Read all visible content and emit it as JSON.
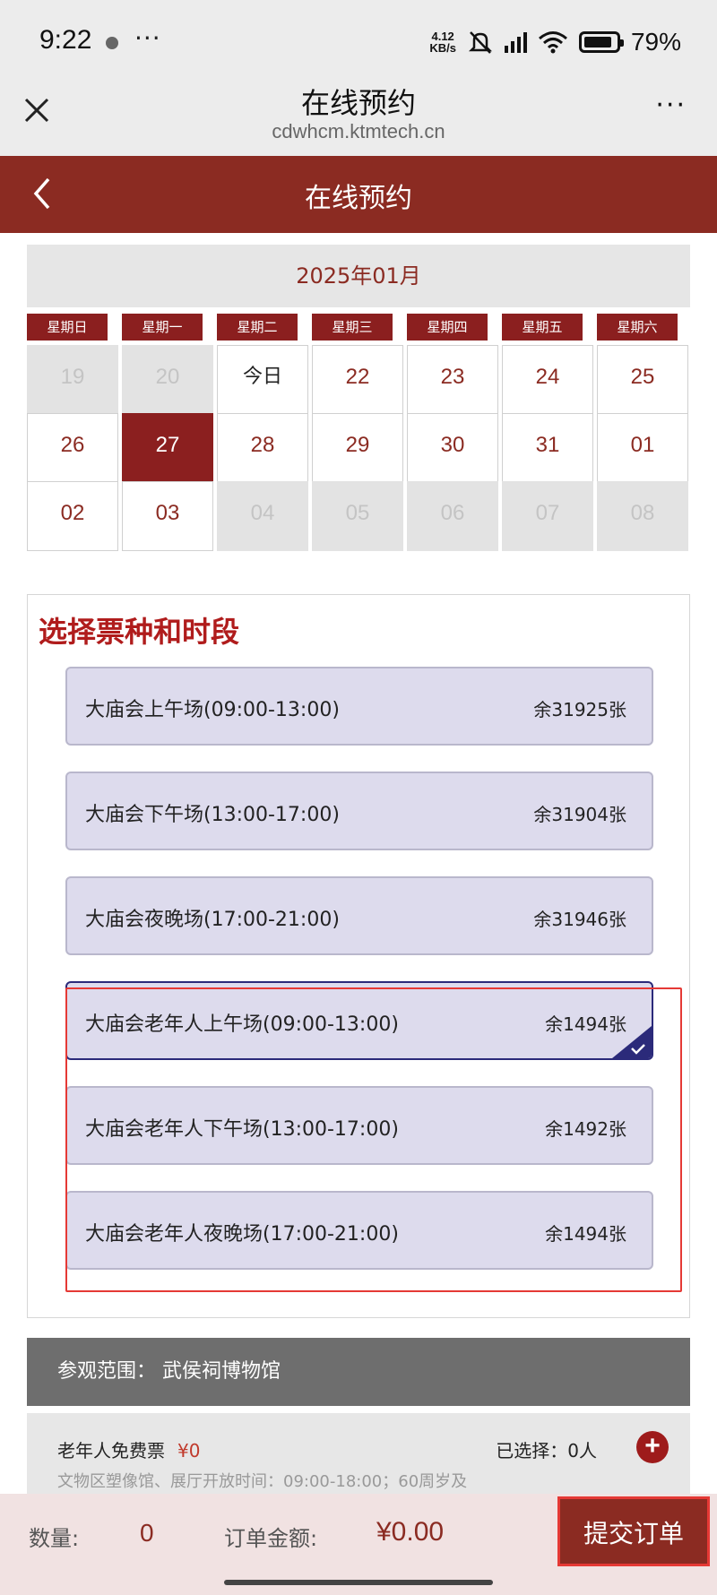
{
  "status": {
    "time": "9:22",
    "more": "···",
    "net_speed_top": "4.12",
    "net_speed_bottom": "KB/s",
    "battery": "79%"
  },
  "browser": {
    "title": "在线预约",
    "url": "cdwhcm.ktmtech.cn",
    "more": "···"
  },
  "header": {
    "title": "在线预约"
  },
  "calendar": {
    "month": "2025年01月",
    "weekdays": [
      "星期日",
      "星期一",
      "星期二",
      "星期三",
      "星期四",
      "星期五",
      "星期六"
    ],
    "days": [
      {
        "label": "19",
        "state": "disabled"
      },
      {
        "label": "20",
        "state": "disabled"
      },
      {
        "label": "今日",
        "state": "today"
      },
      {
        "label": "22",
        "state": "available"
      },
      {
        "label": "23",
        "state": "available"
      },
      {
        "label": "24",
        "state": "available"
      },
      {
        "label": "25",
        "state": "available"
      },
      {
        "label": "26",
        "state": "available"
      },
      {
        "label": "27",
        "state": "selected"
      },
      {
        "label": "28",
        "state": "available"
      },
      {
        "label": "29",
        "state": "available"
      },
      {
        "label": "30",
        "state": "available"
      },
      {
        "label": "31",
        "state": "available"
      },
      {
        "label": "01",
        "state": "available"
      },
      {
        "label": "02",
        "state": "available"
      },
      {
        "label": "03",
        "state": "available"
      },
      {
        "label": "04",
        "state": "disabled"
      },
      {
        "label": "05",
        "state": "disabled"
      },
      {
        "label": "06",
        "state": "disabled"
      },
      {
        "label": "07",
        "state": "disabled"
      },
      {
        "label": "08",
        "state": "disabled"
      }
    ]
  },
  "tickets": {
    "title": "选择票种和时段",
    "items": [
      {
        "name": "大庙会上午场(09:00-13:00)",
        "remaining": "余31925张",
        "selected": false
      },
      {
        "name": "大庙会下午场(13:00-17:00)",
        "remaining": "余31904张",
        "selected": false
      },
      {
        "name": "大庙会夜晚场(17:00-21:00)",
        "remaining": "余31946张",
        "selected": false
      },
      {
        "name": "大庙会老年人上午场(09:00-13:00)",
        "remaining": "余1494张",
        "selected": true
      },
      {
        "name": "大庙会老年人下午场(13:00-17:00)",
        "remaining": "余1492张",
        "selected": false
      },
      {
        "name": "大庙会老年人夜晚场(17:00-21:00)",
        "remaining": "余1494张",
        "selected": false
      }
    ]
  },
  "scope": {
    "text": "参观范围： 武侯祠博物馆"
  },
  "ticket_type": {
    "name": "老年人免费票",
    "price": "¥0",
    "selected_text": "已选择：0人",
    "plus": "+",
    "description": "文物区塑像馆、展厅开放时间：09:00-18:00；60周岁及"
  },
  "footer": {
    "qty_label": "数量:",
    "qty_value": "0",
    "amount_label": "订单金额:",
    "amount_value": "¥0.00",
    "submit_label": "提交订单"
  },
  "colors": {
    "brand": "#8b2b22",
    "weekday_bg": "#8b1f1f",
    "card_bg": "#dddbed",
    "highlight": "#e53935"
  }
}
